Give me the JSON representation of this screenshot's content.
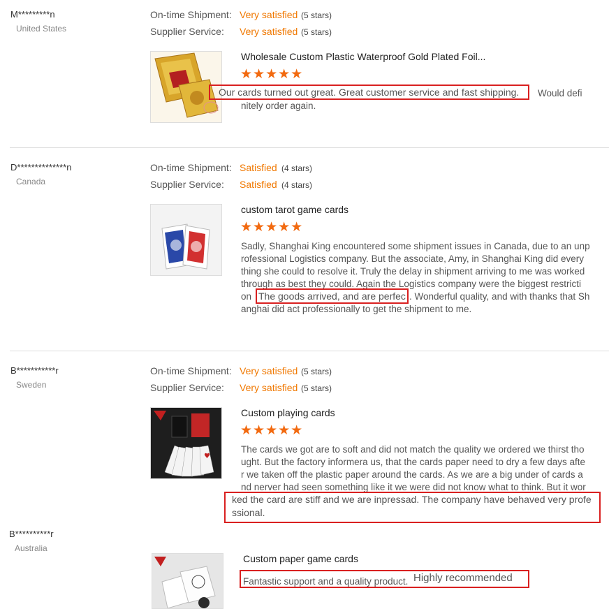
{
  "reviews": [
    {
      "username": "M*********n",
      "country": "United States",
      "shipment_label": "On-time Shipment:",
      "shipment_value": "Very satisfied",
      "shipment_stars": "(5 stars)",
      "service_label": "Supplier Service:",
      "service_value": "Very satisfied",
      "service_stars": "(5 stars)",
      "product_title": "Wholesale Custom Plastic Waterproof Gold Plated Foil...",
      "rating_stars": "★★★★★",
      "rating": 5,
      "text_highlight": "Our cards turned out great.  Great customer service and fast shipping.",
      "text_after": "Would defi",
      "text_line2": "nitely order again."
    },
    {
      "username": "D**************n",
      "country": "Canada",
      "shipment_label": "On-time Shipment:",
      "shipment_value": "Satisfied",
      "shipment_stars": "(4 stars)",
      "service_label": "Supplier Service:",
      "service_value": "Satisfied",
      "service_stars": "(4 stars)",
      "product_title": "custom tarot game cards",
      "rating_stars": "★★★★★",
      "rating": 5,
      "text_lines": [
        "Sadly, Shanghai King encountered some shipment issues in Canada, due to an unp",
        "rofessional Logistics company.  But the associate, Amy, in Shanghai King did every",
        "thing she could to resolve it.  Truly the delay in shipment arriving to me was worked",
        "through as best they could.  Again the Logistics company were the biggest restricti"
      ],
      "line5_pre": "on",
      "line5_highlight": "The goods arrived, and are perfec",
      "line5_post": ". Wonderful quality, and with thanks that Sh",
      "text_line6": "anghai did act professionally to get the shipment to me."
    },
    {
      "username": "B***********r",
      "country": "Sweden",
      "shipment_label": "On-time Shipment:",
      "shipment_value": "Very satisfied",
      "shipment_stars": "(5 stars)",
      "service_label": "Supplier Service:",
      "service_value": "Very satisfied",
      "service_stars": "(5 stars)",
      "product_title": "Custom playing cards",
      "rating_stars": "★★★★★",
      "rating": 5,
      "text_lines": [
        "The cards we got are to soft and did not match the quality we ordered we thirst tho",
        "ught. But the factory informera us, that the cards paper need to dry a few days afte",
        "r we taken off the plastic paper around the cards. As we are a big under of cards a",
        "nd nerver had seen something like it we were did not know what to think. But it wor"
      ],
      "highlight_line1": "ked the card are stiff and we are inpressad. The company have behaved very profe",
      "highlight_line2": "ssional."
    },
    {
      "username": "B**********r",
      "country": "Australia",
      "product_title": "Custom paper game cards",
      "text_main": "Fantastic support and a quality product.",
      "text_extra": "Highly recommended"
    }
  ],
  "colors": {
    "accent": "#f07800",
    "star": "#f26a10",
    "highlight_box": "#d92020"
  }
}
